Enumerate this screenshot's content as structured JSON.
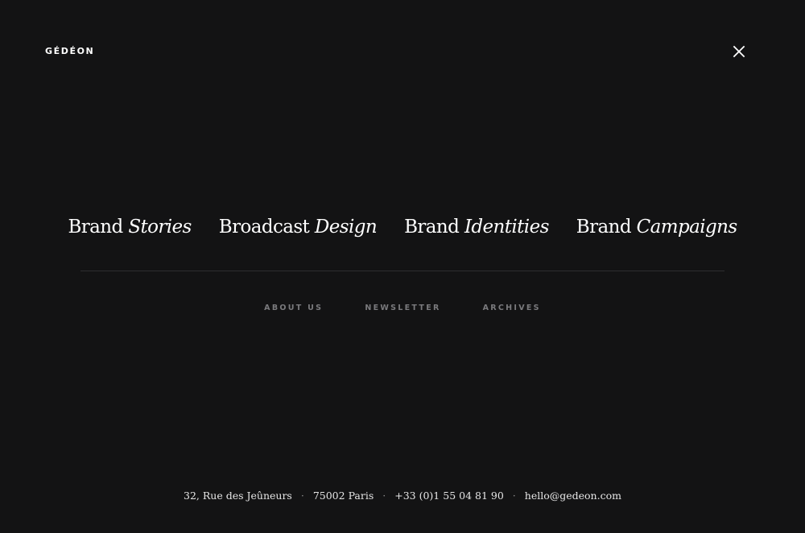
{
  "header": {
    "logo": "GÉDÉON",
    "close_icon": "close-icon"
  },
  "main_nav": [
    {
      "word": "Brand",
      "italic": "Stories"
    },
    {
      "word": "Broadcast",
      "italic": "Design"
    },
    {
      "word": "Brand",
      "italic": "Identities"
    },
    {
      "word": "Brand",
      "italic": "Campaigns"
    }
  ],
  "secondary_nav": {
    "about": "ABOUT US",
    "newsletter": "NEWSLETTER",
    "archives": "ARCHIVES"
  },
  "footer": {
    "address": "32, Rue des Jeûneurs",
    "city": "75002 Paris",
    "phone": "+33 (0)1 55 04 81 90",
    "email": "hello@gedeon.com",
    "separator": "·"
  },
  "colors": {
    "background": "#131314",
    "text": "#ffffff",
    "muted": "#7a7a7d",
    "divider": "#2e2e30"
  }
}
